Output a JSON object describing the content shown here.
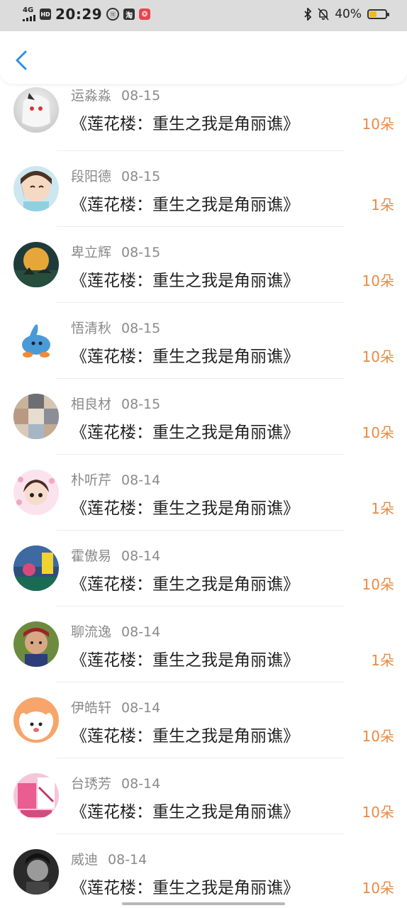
{
  "status_bar": {
    "network": "4G",
    "hd": "HD",
    "time": "20:29",
    "icon2": "⑪",
    "icon3": "淘",
    "battery": "40%"
  },
  "header": {
    "back_icon": "chevron-left-icon"
  },
  "colors": {
    "accent": "#1e90ff",
    "count": "#ea8a44",
    "name": "#8a8a8a"
  },
  "items": [
    {
      "name": "运淼淼",
      "date": "08-15",
      "title": "《莲花楼：重生之我是角丽谯》",
      "count": "10朵"
    },
    {
      "name": "段阳德",
      "date": "08-15",
      "title": "《莲花楼：重生之我是角丽谯》",
      "count": "1朵"
    },
    {
      "name": "卑立辉",
      "date": "08-15",
      "title": "《莲花楼：重生之我是角丽谯》",
      "count": "10朵"
    },
    {
      "name": "悟清秋",
      "date": "08-15",
      "title": "《莲花楼：重生之我是角丽谯》",
      "count": "10朵"
    },
    {
      "name": "相良材",
      "date": "08-15",
      "title": "《莲花楼：重生之我是角丽谯》",
      "count": "10朵"
    },
    {
      "name": "朴听芹",
      "date": "08-14",
      "title": "《莲花楼：重生之我是角丽谯》",
      "count": "1朵"
    },
    {
      "name": "霍傲易",
      "date": "08-14",
      "title": "《莲花楼：重生之我是角丽谯》",
      "count": "10朵"
    },
    {
      "name": "聊流逸",
      "date": "08-14",
      "title": "《莲花楼：重生之我是角丽谯》",
      "count": "1朵"
    },
    {
      "name": "伊皓轩",
      "date": "08-14",
      "title": "《莲花楼：重生之我是角丽谯》",
      "count": "10朵"
    },
    {
      "name": "台琇芳",
      "date": "08-14",
      "title": "《莲花楼：重生之我是角丽谯》",
      "count": "10朵"
    },
    {
      "name": "威迪",
      "date": "08-14",
      "title": "《莲花楼：重生之我是角丽谯》",
      "count": "10朵"
    }
  ]
}
